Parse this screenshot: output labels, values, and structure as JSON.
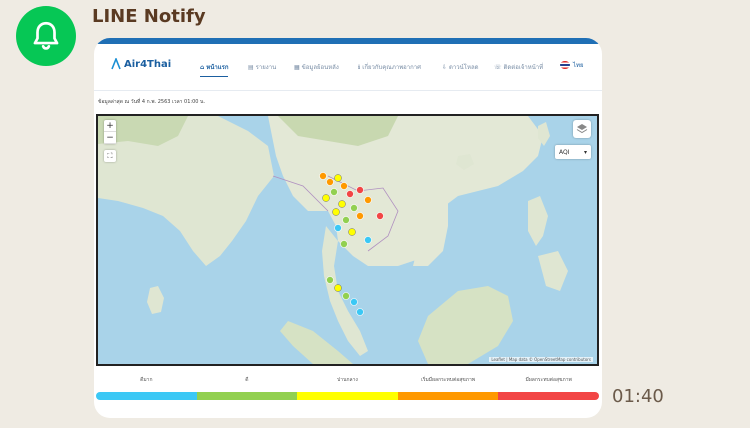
{
  "sender": {
    "name": "LINE Notify",
    "icon": "bell-icon",
    "avatar_color": "#06c755"
  },
  "message": {
    "time": "01:40",
    "page": {
      "logo_text": "Air4Thai",
      "nav_items": [
        {
          "label": "หน้าแรก",
          "icon": "home-icon",
          "active": true
        },
        {
          "label": "รายงาน",
          "icon": "report-icon",
          "active": false
        },
        {
          "label": "ข้อมูลย้อนหลัง",
          "icon": "history-icon",
          "active": false
        },
        {
          "label": "เกี่ยวกับคุณภาพอากาศ",
          "icon": "info-icon",
          "active": false
        },
        {
          "label": "ดาวน์โหลด",
          "icon": "download-icon",
          "active": false
        },
        {
          "label": "ติดต่อเจ้าหน้าที่",
          "icon": "contact-icon",
          "active": false
        }
      ],
      "language": "ไทย",
      "updated_text": "ข้อมูลล่าสุด ณ วันที่ 4 ก.พ. 2563 เวลา 01:00 น.",
      "map": {
        "zoom_in": "+",
        "zoom_out": "−",
        "fullscreen": "⛶",
        "layers_icon": "layers-icon",
        "select_value": "AQI",
        "attribution": "Leaflet | Map data © OpenStreetMap contributors"
      },
      "legend": {
        "labels": [
          "ดีมาก",
          "ดี",
          "ปานกลาง",
          "เริ่มมีผลกระทบต่อสุขภาพ",
          "มีผลกระทบต่อสุขภาพ"
        ],
        "colors": [
          "#3bc8f5",
          "#92d050",
          "#ffff00",
          "#ff9900",
          "#f24545"
        ]
      }
    }
  }
}
